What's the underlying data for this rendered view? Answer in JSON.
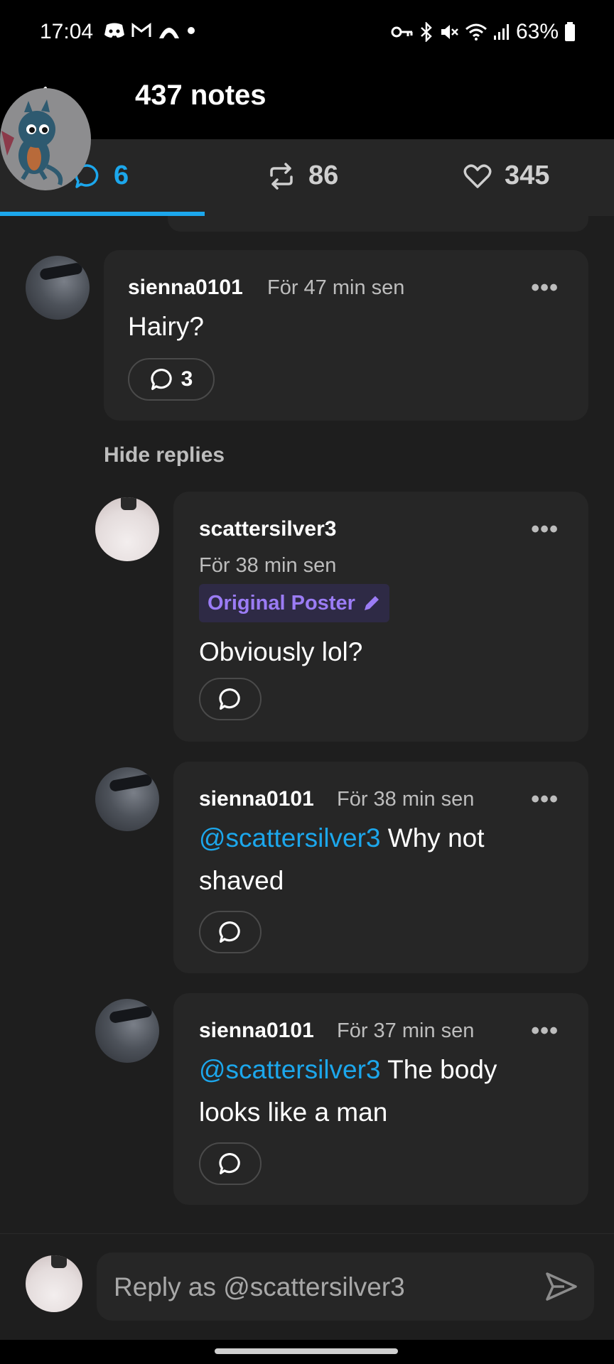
{
  "status_bar": {
    "time": "17:04",
    "battery": "63%",
    "icons": [
      "discord-icon",
      "gmail-icon",
      "mountain-app-icon",
      "dot-icon",
      "vpn-key-icon",
      "bluetooth-icon",
      "mute-icon",
      "wifi-icon",
      "signal-icon",
      "battery-icon"
    ]
  },
  "header": {
    "title": "437 notes"
  },
  "tabs": [
    {
      "name": "replies",
      "count": "6",
      "icon": "comment-icon",
      "active": true
    },
    {
      "name": "reblogs",
      "count": "86",
      "icon": "reblog-icon",
      "active": false
    },
    {
      "name": "likes",
      "count": "345",
      "icon": "heart-icon",
      "active": false
    }
  ],
  "comments": [
    {
      "username": "sienna0101",
      "time": "För 47 min sen",
      "text": "Hairy?",
      "reply_count": "3",
      "more": "•••"
    }
  ],
  "hide_replies_label": "Hide replies",
  "replies": [
    {
      "username": "scattersilver3",
      "time": "För 38 min sen",
      "badge": "Original Poster",
      "text": "Obviously lol?",
      "more": "•••"
    },
    {
      "username": "sienna0101",
      "time": "För 38 min sen",
      "mention": "@scattersilver3",
      "text_line1": " Why not",
      "text_line2": "shaved",
      "more": "•••"
    },
    {
      "username": "sienna0101",
      "time": "För 37 min sen",
      "mention": "@scattersilver3",
      "text_line1": " The body",
      "text_line2": "looks like a man",
      "more": "•••"
    }
  ],
  "reply_bar": {
    "placeholder": "Reply as @scattersilver3"
  },
  "colors": {
    "accent": "#1ca7ec",
    "op_badge": "#9b7cf5",
    "card": "#262626",
    "background": "#1e1e1e"
  }
}
